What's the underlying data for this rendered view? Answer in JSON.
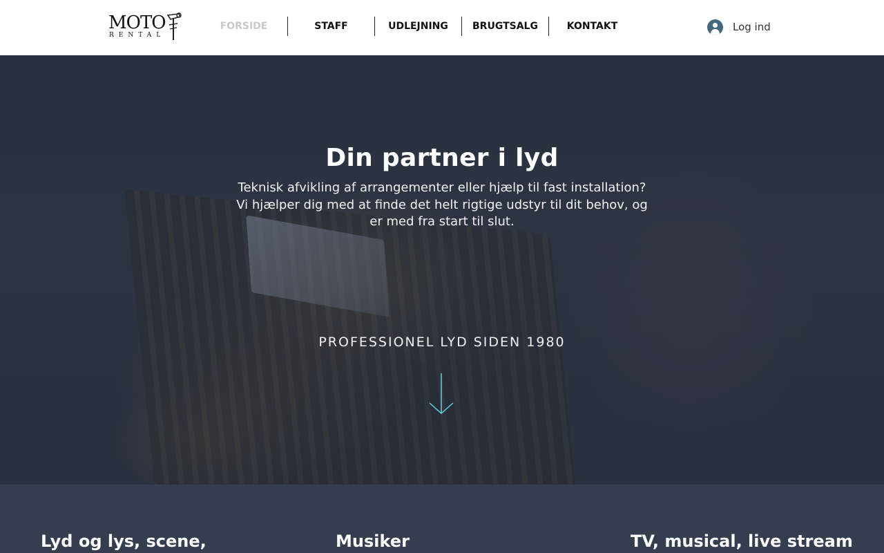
{
  "brand": {
    "logo_word": "MOTO",
    "logo_sub": "RENTAL"
  },
  "nav": {
    "items": [
      {
        "label": "FORSIDE",
        "active": true
      },
      {
        "label": "STAFF"
      },
      {
        "label": "UDLEJNING"
      },
      {
        "label": "BRUGTSALG"
      },
      {
        "label": "KONTAKT"
      }
    ]
  },
  "account": {
    "login_label": "Log ind",
    "icon": "user-avatar-icon"
  },
  "hero": {
    "title": "Din partner i lyd",
    "subtitle": "Teknisk afvikling af arrangementer eller hjælp til fast installation? Vi hjælper dig med at finde det helt rigtige udstyr til dit behov, og er med fra start til slut.",
    "tagline": "PROFESSIONEL LYD SIDEN 1980",
    "scroll_icon": "arrow-down-icon"
  },
  "services": {
    "headings": [
      "Lyd og lys, scene,",
      "Musiker",
      "TV, musical, live stream"
    ]
  },
  "colors": {
    "band_background": "#343e4f",
    "accent_arrow": "#5fd4e0",
    "nav_active": "#c9c9c9",
    "avatar": "#44687c"
  }
}
